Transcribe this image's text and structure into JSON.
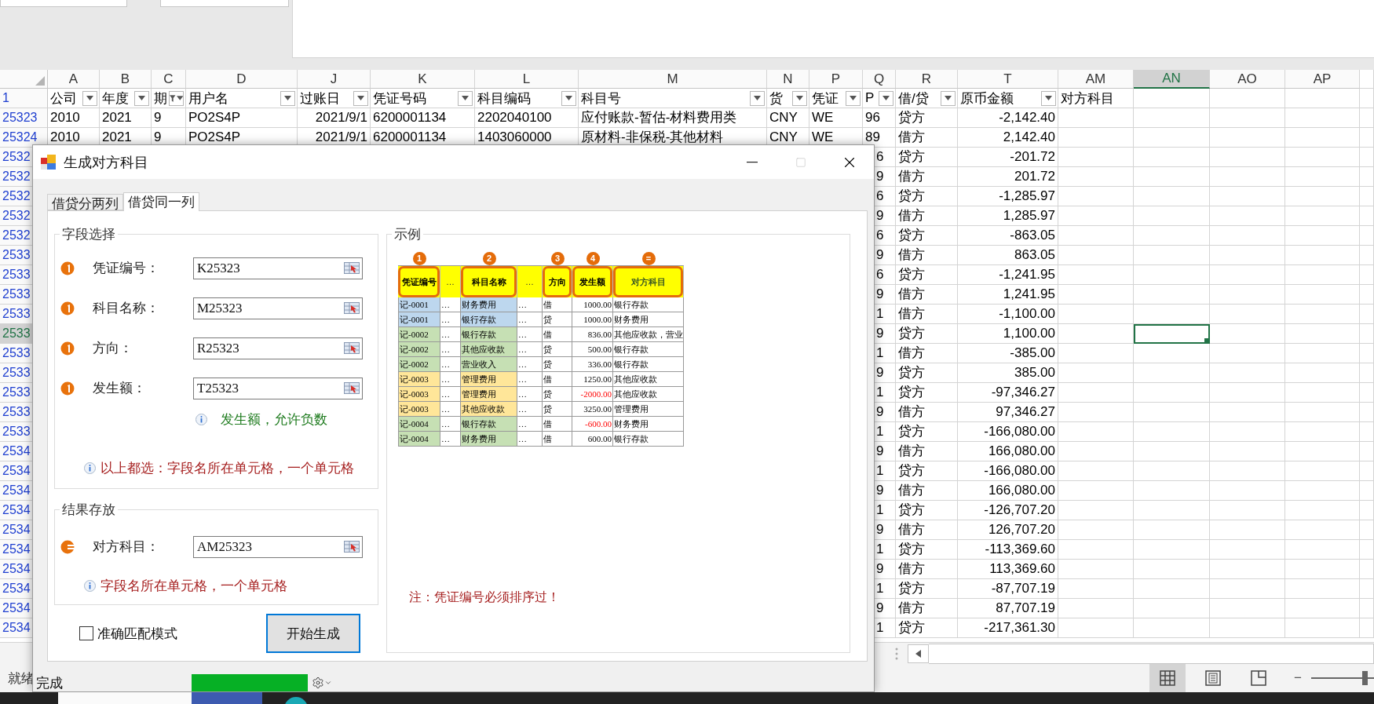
{
  "sheet": {
    "header_row_number": "1",
    "columns": [
      {
        "letter": "A",
        "heading": "公司",
        "kind": "filter",
        "selected": false
      },
      {
        "letter": "B",
        "heading": "年度",
        "kind": "filter",
        "selected": false
      },
      {
        "letter": "C",
        "heading": "期",
        "kind": "filtered",
        "selected": false
      },
      {
        "letter": "D",
        "heading": "用户名",
        "kind": "filter",
        "selected": false
      },
      {
        "letter": "J",
        "heading": "过账日",
        "kind": "filter",
        "selected": false
      },
      {
        "letter": "K",
        "heading": "凭证号码",
        "kind": "filter",
        "selected": false
      },
      {
        "letter": "L",
        "heading": "科目编码",
        "kind": "filter",
        "selected": false
      },
      {
        "letter": "M",
        "heading": "科目号",
        "kind": "filter",
        "selected": false
      },
      {
        "letter": "N",
        "heading": "货",
        "kind": "filter",
        "selected": false
      },
      {
        "letter": "P",
        "heading": "凭证",
        "kind": "filter",
        "selected": false
      },
      {
        "letter": "Q",
        "heading": "P",
        "kind": "filter",
        "selected": false
      },
      {
        "letter": "R",
        "heading": "借/贷",
        "kind": "filter",
        "selected": false
      },
      {
        "letter": "T",
        "heading": "原币金额",
        "kind": "filter",
        "selected": false
      },
      {
        "letter": "AM",
        "heading": "对方科目",
        "kind": "plain",
        "selected": false
      },
      {
        "letter": "AN",
        "selected": true
      },
      {
        "letter": "AO",
        "selected": false
      },
      {
        "letter": "AP",
        "selected": false
      }
    ],
    "rows": [
      {
        "number": "25323",
        "kind": "full",
        "selected": false,
        "cells": [
          "2010",
          "2021",
          "9",
          "PO2S4P",
          "2021/9/1",
          "6200001134",
          "2202040100",
          "应付账款-暂估-材料费用类",
          "CNY",
          "WE",
          "96",
          "贷方",
          "-2,142.40"
        ]
      },
      {
        "number": "25324",
        "kind": "full",
        "selected": false,
        "cells": [
          "2010",
          "2021",
          "9",
          "PO2S4P",
          "2021/9/1",
          "6200001134",
          "1403060000",
          "原材料-非保税-其他材料",
          "CNY",
          "WE",
          "89",
          "借方",
          "2,142.40"
        ]
      },
      {
        "number": "2532",
        "kind": "covered",
        "selected": false,
        "cells": [
          "6",
          "贷方",
          "-201.72"
        ]
      },
      {
        "number": "2532",
        "kind": "covered",
        "selected": false,
        "cells": [
          "9",
          "借方",
          "201.72"
        ]
      },
      {
        "number": "2532",
        "kind": "covered",
        "selected": false,
        "cells": [
          "6",
          "贷方",
          "-1,285.97"
        ]
      },
      {
        "number": "2532",
        "kind": "covered",
        "selected": false,
        "cells": [
          "9",
          "借方",
          "1,285.97"
        ]
      },
      {
        "number": "2532",
        "kind": "covered",
        "selected": false,
        "cells": [
          "6",
          "贷方",
          "-863.05"
        ]
      },
      {
        "number": "2533",
        "kind": "covered",
        "selected": false,
        "cells": [
          "9",
          "借方",
          "863.05"
        ]
      },
      {
        "number": "2533",
        "kind": "covered",
        "selected": false,
        "cells": [
          "6",
          "贷方",
          "-1,241.95"
        ]
      },
      {
        "number": "2533",
        "kind": "covered",
        "selected": false,
        "cells": [
          "9",
          "借方",
          "1,241.95"
        ]
      },
      {
        "number": "2533",
        "kind": "covered",
        "selected": false,
        "cells": [
          "1",
          "借方",
          "-1,100.00"
        ]
      },
      {
        "number": "2533",
        "kind": "covered",
        "selected": true,
        "cells": [
          "9",
          "贷方",
          "1,100.00"
        ]
      },
      {
        "number": "2533",
        "kind": "covered",
        "selected": false,
        "cells": [
          "1",
          "借方",
          "-385.00"
        ]
      },
      {
        "number": "2533",
        "kind": "covered",
        "selected": false,
        "cells": [
          "9",
          "贷方",
          "385.00"
        ]
      },
      {
        "number": "2533",
        "kind": "covered",
        "selected": false,
        "cells": [
          "1",
          "贷方",
          "-97,346.27"
        ]
      },
      {
        "number": "2533",
        "kind": "covered",
        "selected": false,
        "cells": [
          "9",
          "借方",
          "97,346.27"
        ]
      },
      {
        "number": "2533",
        "kind": "covered",
        "selected": false,
        "cells": [
          "1",
          "贷方",
          "-166,080.00"
        ]
      },
      {
        "number": "2534",
        "kind": "covered",
        "selected": false,
        "cells": [
          "9",
          "借方",
          "166,080.00"
        ]
      },
      {
        "number": "2534",
        "kind": "covered",
        "selected": false,
        "cells": [
          "1",
          "贷方",
          "-166,080.00"
        ]
      },
      {
        "number": "2534",
        "kind": "covered",
        "selected": false,
        "cells": [
          "9",
          "借方",
          "166,080.00"
        ]
      },
      {
        "number": "2534",
        "kind": "covered",
        "selected": false,
        "cells": [
          "1",
          "贷方",
          "-126,707.20"
        ]
      },
      {
        "number": "2534",
        "kind": "covered",
        "selected": false,
        "cells": [
          "9",
          "借方",
          "126,707.20"
        ]
      },
      {
        "number": "2534",
        "kind": "covered",
        "selected": false,
        "cells": [
          "1",
          "贷方",
          "-113,369.60"
        ]
      },
      {
        "number": "2534",
        "kind": "covered",
        "selected": false,
        "cells": [
          "9",
          "借方",
          "113,369.60"
        ]
      },
      {
        "number": "2534",
        "kind": "covered",
        "selected": false,
        "cells": [
          "1",
          "贷方",
          "-87,707.19"
        ]
      },
      {
        "number": "2534",
        "kind": "covered",
        "selected": false,
        "cells": [
          "9",
          "借方",
          "87,707.19"
        ]
      },
      {
        "number": "2534",
        "kind": "covered",
        "selected": false,
        "cells": [
          "1",
          "贷方",
          "-217,361.30"
        ]
      }
    ]
  },
  "status_bar": {
    "status": "就绪",
    "views": [
      {
        "kind": "normal",
        "selected": true
      },
      {
        "kind": "page_layout",
        "selected": false
      },
      {
        "kind": "page_break",
        "selected": false
      }
    ],
    "zoom_out": "−",
    "zoom": {
      "level": 0.85
    }
  },
  "dialog": {
    "title": "生成对方科目",
    "tabs": [
      {
        "label": "借贷分两列",
        "selected": false
      },
      {
        "label": "借贷同一列",
        "selected": true
      }
    ],
    "field_group": {
      "legend": "字段选择",
      "fields": [
        {
          "kind": "source",
          "label": "凭证编号：",
          "value": "K25323"
        },
        {
          "kind": "source",
          "label": "科目名称：",
          "value": "M25323"
        },
        {
          "kind": "source",
          "label": "方向：",
          "value": "R25323"
        },
        {
          "kind": "source",
          "label": "发生额：",
          "value": "T25323"
        }
      ],
      "notes": [
        {
          "kind": "hint",
          "text": "发生额，允许负数"
        },
        {
          "kind": "warning",
          "text": "以上都选：字段名所在单元格，一个单元格"
        }
      ]
    },
    "result_group": {
      "legend": "结果存放",
      "fields": [
        {
          "kind": "result",
          "label": "对方科目：",
          "value": "AM25323"
        }
      ],
      "notes": [
        {
          "kind": "warning",
          "text": "字段名所在单元格，一个单元格"
        }
      ]
    },
    "exact_match": {
      "label": "准确匹配模式",
      "checked": false
    },
    "start_button": "开始生成",
    "example": {
      "legend": "示例",
      "columns": [
        {
          "kind": "field",
          "label": "凭证编号",
          "marker": "1"
        },
        {
          "kind": "gap",
          "label": "…"
        },
        {
          "kind": "field",
          "label": "科目名称",
          "marker": "2"
        },
        {
          "kind": "gap",
          "label": "…"
        },
        {
          "kind": "field",
          "label": "方向",
          "marker": "3"
        },
        {
          "kind": "field",
          "label": "发生额",
          "marker": "4"
        },
        {
          "kind": "result",
          "label": "对方科目",
          "marker": "="
        }
      ],
      "rows": [
        {
          "color": "#bdd7ee",
          "negative": false,
          "cells": [
            "记-0001",
            "…",
            "财务费用",
            "…",
            "借",
            "1000.00",
            "银行存款"
          ]
        },
        {
          "color": "#bdd7ee",
          "negative": false,
          "cells": [
            "记-0001",
            "…",
            "银行存款",
            "…",
            "贷",
            "1000.00",
            "财务费用"
          ]
        },
        {
          "color": "#c6e0b4",
          "negative": false,
          "cells": [
            "记-0002",
            "…",
            "银行存款",
            "…",
            "借",
            "836.00",
            "其他应收款，营业"
          ]
        },
        {
          "color": "#c6e0b4",
          "negative": false,
          "cells": [
            "记-0002",
            "…",
            "其他应收款",
            "…",
            "贷",
            "500.00",
            "银行存款"
          ]
        },
        {
          "color": "#c6e0b4",
          "negative": false,
          "cells": [
            "记-0002",
            "…",
            "营业收入",
            "…",
            "贷",
            "336.00",
            "银行存款"
          ]
        },
        {
          "color": "#ffe699",
          "negative": false,
          "cells": [
            "记-0003",
            "…",
            "管理费用",
            "…",
            "借",
            "1250.00",
            "其他应收款"
          ]
        },
        {
          "color": "#ffe699",
          "negative": true,
          "cells": [
            "记-0003",
            "…",
            "管理费用",
            "…",
            "贷",
            "-2000.00",
            "其他应收款"
          ]
        },
        {
          "color": "#ffe699",
          "negative": false,
          "cells": [
            "记-0003",
            "…",
            "其他应收款",
            "…",
            "贷",
            "3250.00",
            "管理费用"
          ]
        },
        {
          "color": "#c6e0b4",
          "negative": true,
          "cells": [
            "记-0004",
            "…",
            "银行存款",
            "…",
            "借",
            "-600.00",
            "财务费用"
          ]
        },
        {
          "color": "#c6e0b4",
          "negative": false,
          "cells": [
            "记-0004",
            "…",
            "财务费用",
            "…",
            "借",
            "600.00",
            "银行存款"
          ]
        }
      ],
      "note": "注：凭证编号必须排序过！"
    },
    "status": {
      "text": "完成",
      "level": 1
    }
  }
}
